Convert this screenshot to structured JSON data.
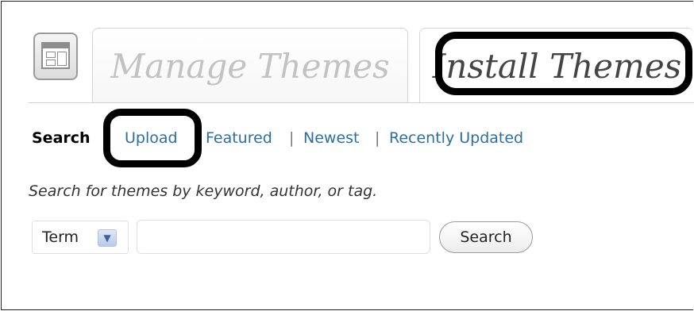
{
  "tabs": {
    "manage": "Manage Themes",
    "install": "Install Themes"
  },
  "subnav": {
    "items": [
      {
        "label": "Search"
      },
      {
        "label": "Upload"
      },
      {
        "label": "Featured"
      },
      {
        "label": "Newest"
      },
      {
        "label": "Recently Updated"
      }
    ],
    "separator": "|"
  },
  "search_form": {
    "description": "Search for themes by keyword, author, or tag.",
    "select_value": "Term",
    "input_value": "",
    "button_label": "Search"
  },
  "icons": {
    "page": "appearance-icon",
    "dropdown": "chevron-down-icon"
  },
  "colors": {
    "link": "#2a6fa0",
    "highlight_outline": "#000000"
  }
}
